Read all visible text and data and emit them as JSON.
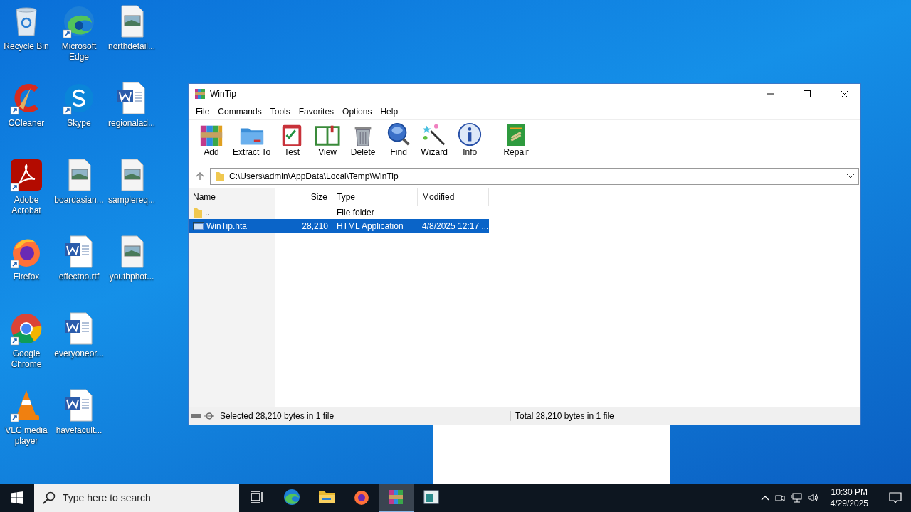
{
  "desktop": {
    "icons": [
      {
        "label": "Recycle Bin",
        "kind": "recycle",
        "shortcut": false
      },
      {
        "label": "CCleaner",
        "kind": "ccleaner",
        "shortcut": true
      },
      {
        "label": "Adobe Acrobat",
        "kind": "acrobat",
        "shortcut": true
      },
      {
        "label": "Firefox",
        "kind": "firefox",
        "shortcut": true
      },
      {
        "label": "Google Chrome",
        "kind": "chrome",
        "shortcut": true
      },
      {
        "label": "VLC media player",
        "kind": "vlc",
        "shortcut": true
      },
      {
        "label": "Microsoft Edge",
        "kind": "edge",
        "shortcut": true
      },
      {
        "label": "Skype",
        "kind": "skype",
        "shortcut": true
      },
      {
        "label": "boardasian...",
        "kind": "image",
        "shortcut": false
      },
      {
        "label": "effectno.rtf",
        "kind": "word",
        "shortcut": false
      },
      {
        "label": "everyoneor...",
        "kind": "word",
        "shortcut": false
      },
      {
        "label": "havefacult...",
        "kind": "word",
        "shortcut": false
      },
      {
        "label": "northdetail...",
        "kind": "image",
        "shortcut": false
      },
      {
        "label": "regionalad...",
        "kind": "word",
        "shortcut": false
      },
      {
        "label": "samplereq...",
        "kind": "image",
        "shortcut": false
      },
      {
        "label": "youthphot...",
        "kind": "image",
        "shortcut": false
      }
    ]
  },
  "window": {
    "title": "WinTip",
    "menu": [
      "File",
      "Commands",
      "Tools",
      "Favorites",
      "Options",
      "Help"
    ],
    "toolbar": [
      {
        "label": "Add",
        "kind": "add"
      },
      {
        "label": "Extract To",
        "kind": "extract"
      },
      {
        "label": "Test",
        "kind": "test"
      },
      {
        "label": "View",
        "kind": "view"
      },
      {
        "label": "Delete",
        "kind": "delete"
      },
      {
        "label": "Find",
        "kind": "find"
      },
      {
        "label": "Wizard",
        "kind": "wizard"
      },
      {
        "label": "Info",
        "kind": "info"
      },
      {
        "label": "Repair",
        "kind": "repair"
      }
    ],
    "path": "C:\\Users\\admin\\AppData\\Local\\Temp\\WinTip",
    "columns": [
      "Name",
      "Size",
      "Type",
      "Modified"
    ],
    "rows": [
      {
        "name": "..",
        "type": "File folder",
        "kind": "folder",
        "selected": false
      },
      {
        "name": "WinTip.hta",
        "size": "28,210",
        "type": "HTML Application",
        "modified": "4/8/2025 12:17 ...",
        "kind": "file",
        "selected": true
      }
    ],
    "status_bar": {
      "left": "Selected 28,210 bytes in 1 file",
      "right": "Total 28,210 bytes in 1 file"
    }
  },
  "taskbar": {
    "search": {
      "placeholder": "Type here to search"
    },
    "apps": [
      {
        "kind": "taskview",
        "active": false
      },
      {
        "kind": "edge",
        "active": false
      },
      {
        "kind": "explorer",
        "active": false
      },
      {
        "kind": "firefox",
        "active": false
      },
      {
        "kind": "winrar",
        "active": true
      },
      {
        "kind": "window",
        "active": false
      }
    ],
    "time": "10:30 PM",
    "date": "4/29/2025"
  }
}
